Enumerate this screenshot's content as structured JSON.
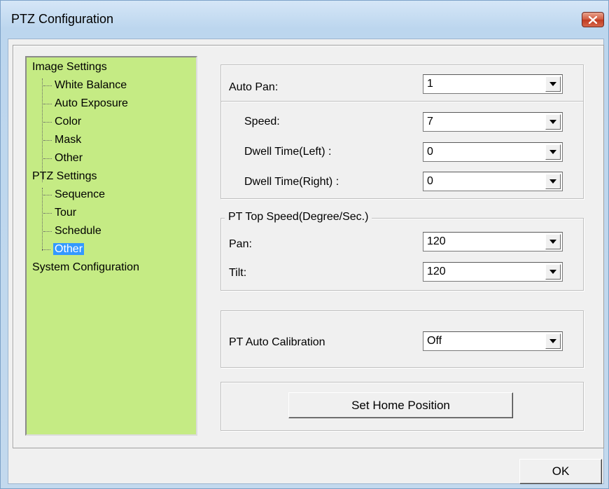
{
  "window": {
    "title": "PTZ Configuration"
  },
  "tree": {
    "items": [
      {
        "label": "Image Settings"
      },
      {
        "label": "White Balance"
      },
      {
        "label": "Auto Exposure"
      },
      {
        "label": "Color"
      },
      {
        "label": "Mask"
      },
      {
        "label": "Other"
      },
      {
        "label": "PTZ Settings"
      },
      {
        "label": "Sequence"
      },
      {
        "label": "Tour"
      },
      {
        "label": "Schedule"
      },
      {
        "label": "Other"
      },
      {
        "label": "System Configuration"
      }
    ],
    "selected_index": 10,
    "background_color": "#c5eb84",
    "selection_color": "#3399ff"
  },
  "auto_pan": {
    "label": "Auto Pan:",
    "value": "1",
    "speed_label": "Speed:",
    "speed_value": "7",
    "dwell_left_label": "Dwell Time(Left) :",
    "dwell_left_value": "0",
    "dwell_right_label": "Dwell Time(Right) :",
    "dwell_right_value": "0"
  },
  "top_speed": {
    "title": "PT Top Speed(Degree/Sec.)",
    "pan_label": "Pan:",
    "pan_value": "120",
    "tilt_label": "Tilt:",
    "tilt_value": "120"
  },
  "calibration": {
    "label": "PT Auto Calibration",
    "value": "Off"
  },
  "home": {
    "button_label": "Set Home Position"
  },
  "footer": {
    "ok_label": "OK"
  },
  "icons": {
    "close": "close-icon",
    "dropdown": "dropdown-arrow-icon"
  }
}
